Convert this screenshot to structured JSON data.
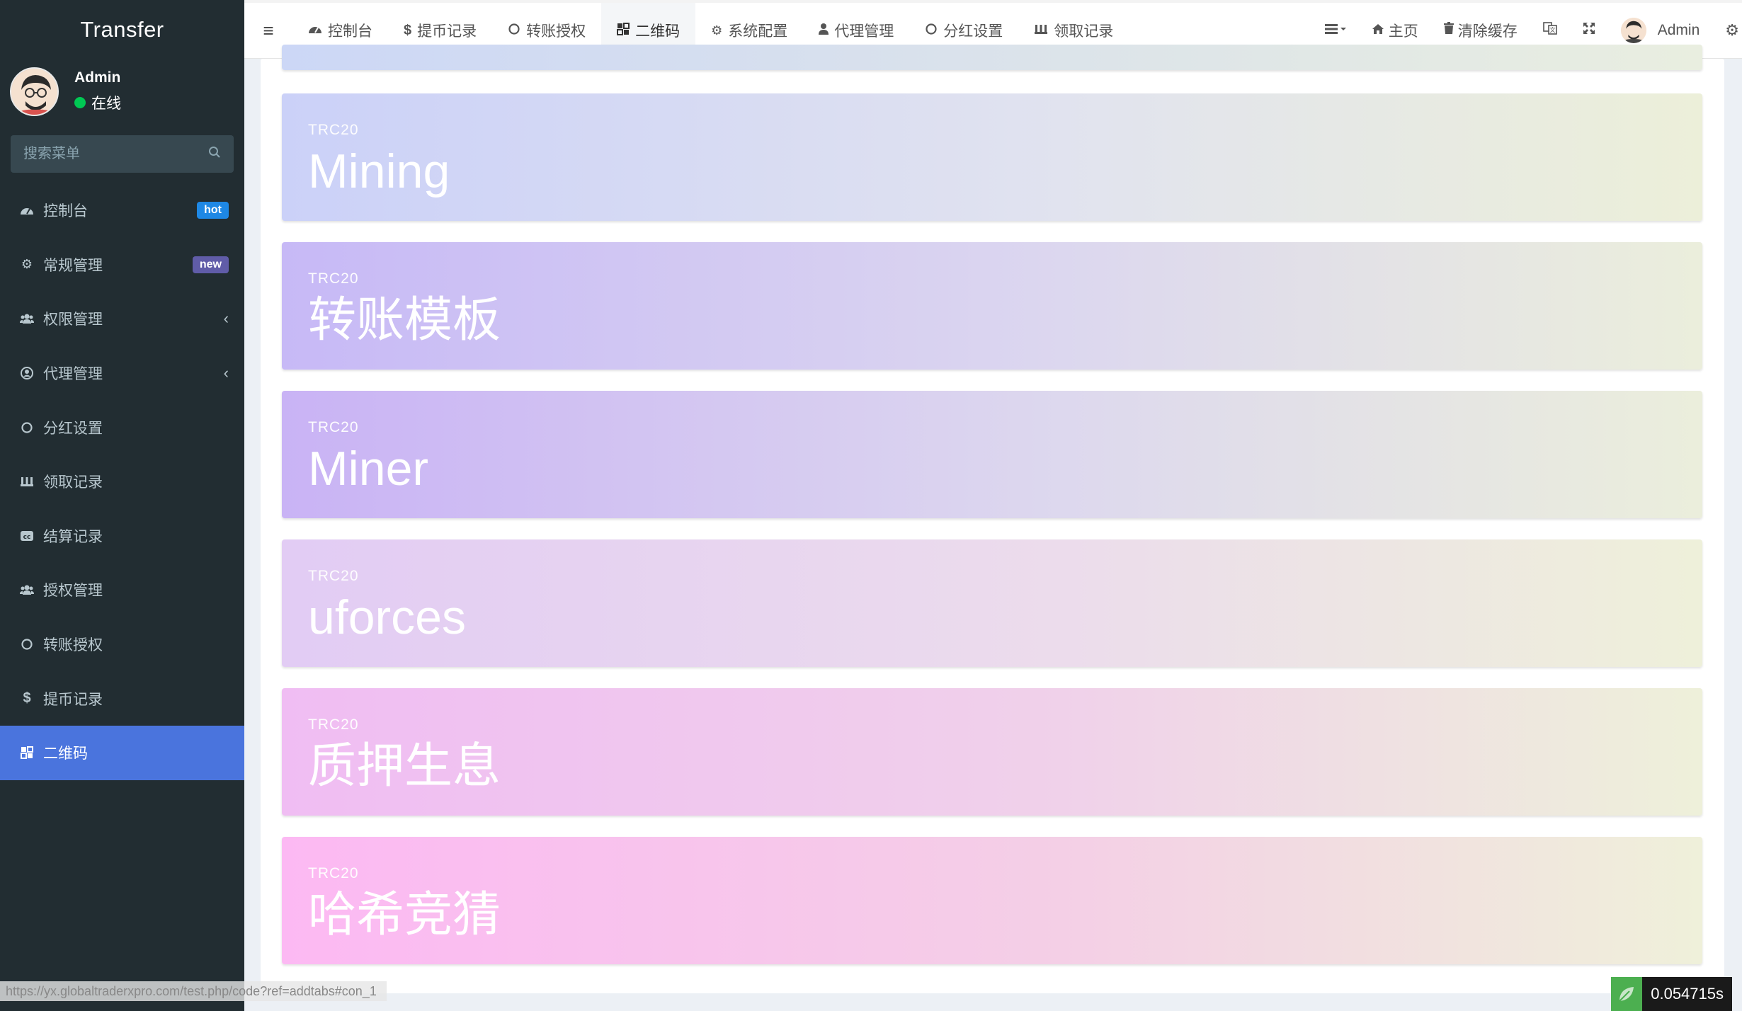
{
  "app": {
    "title": "Transfer"
  },
  "user": {
    "name": "Admin",
    "status": "在线"
  },
  "search": {
    "placeholder": "搜索菜单"
  },
  "sidebar": {
    "items": [
      {
        "label": "控制台",
        "icon": "dashboard-icon",
        "badge": "hot"
      },
      {
        "label": "常规管理",
        "icon": "cogs-icon",
        "badge": "new"
      },
      {
        "label": "权限管理",
        "icon": "group-icon"
      },
      {
        "label": "代理管理",
        "icon": "user-circle-icon"
      },
      {
        "label": "分红设置",
        "icon": "circle-icon"
      },
      {
        "label": "领取记录",
        "icon": "fort-icon"
      },
      {
        "label": "结算记录",
        "icon": "cc-icon"
      },
      {
        "label": "授权管理",
        "icon": "group-icon"
      },
      {
        "label": "转账授权",
        "icon": "circle-icon"
      },
      {
        "label": "提币记录",
        "icon": "dollar-icon"
      },
      {
        "label": "二维码",
        "icon": "qrcode-icon",
        "active": true
      }
    ]
  },
  "topnav": {
    "tabs": [
      {
        "label": "控制台",
        "icon": "dashboard-icon"
      },
      {
        "label": "提币记录",
        "icon": "dollar-icon"
      },
      {
        "label": "转账授权",
        "icon": "circle-icon"
      },
      {
        "label": "二维码",
        "icon": "qrcode-icon",
        "active": true
      },
      {
        "label": "系统配置",
        "icon": "cog-icon"
      },
      {
        "label": "代理管理",
        "icon": "user-icon"
      },
      {
        "label": "分红设置",
        "icon": "circle-icon"
      },
      {
        "label": "领取记录",
        "icon": "fort-icon"
      }
    ],
    "right": {
      "home": "主页",
      "clear_cache": "清除缓存",
      "user": "Admin"
    }
  },
  "cards": [
    {
      "sub": "TRC20",
      "title": "Mining"
    },
    {
      "sub": "TRC20",
      "title": "转账模板"
    },
    {
      "sub": "TRC20",
      "title": "Miner"
    },
    {
      "sub": "TRC20",
      "title": "uforces"
    },
    {
      "sub": "TRC20",
      "title": "质押生息"
    },
    {
      "sub": "TRC20",
      "title": "哈希竞猜"
    }
  ],
  "statusbar": {
    "url": "https://yx.globaltraderxpro.com/test.php/code?ref=addtabs#con_1"
  },
  "timer": {
    "value": "0.054715s"
  },
  "colors": {
    "sidebar_bg": "#222d32",
    "active_item": "#4a74dd",
    "badge_hot": "#1e88e5",
    "badge_new": "#605ca8"
  }
}
